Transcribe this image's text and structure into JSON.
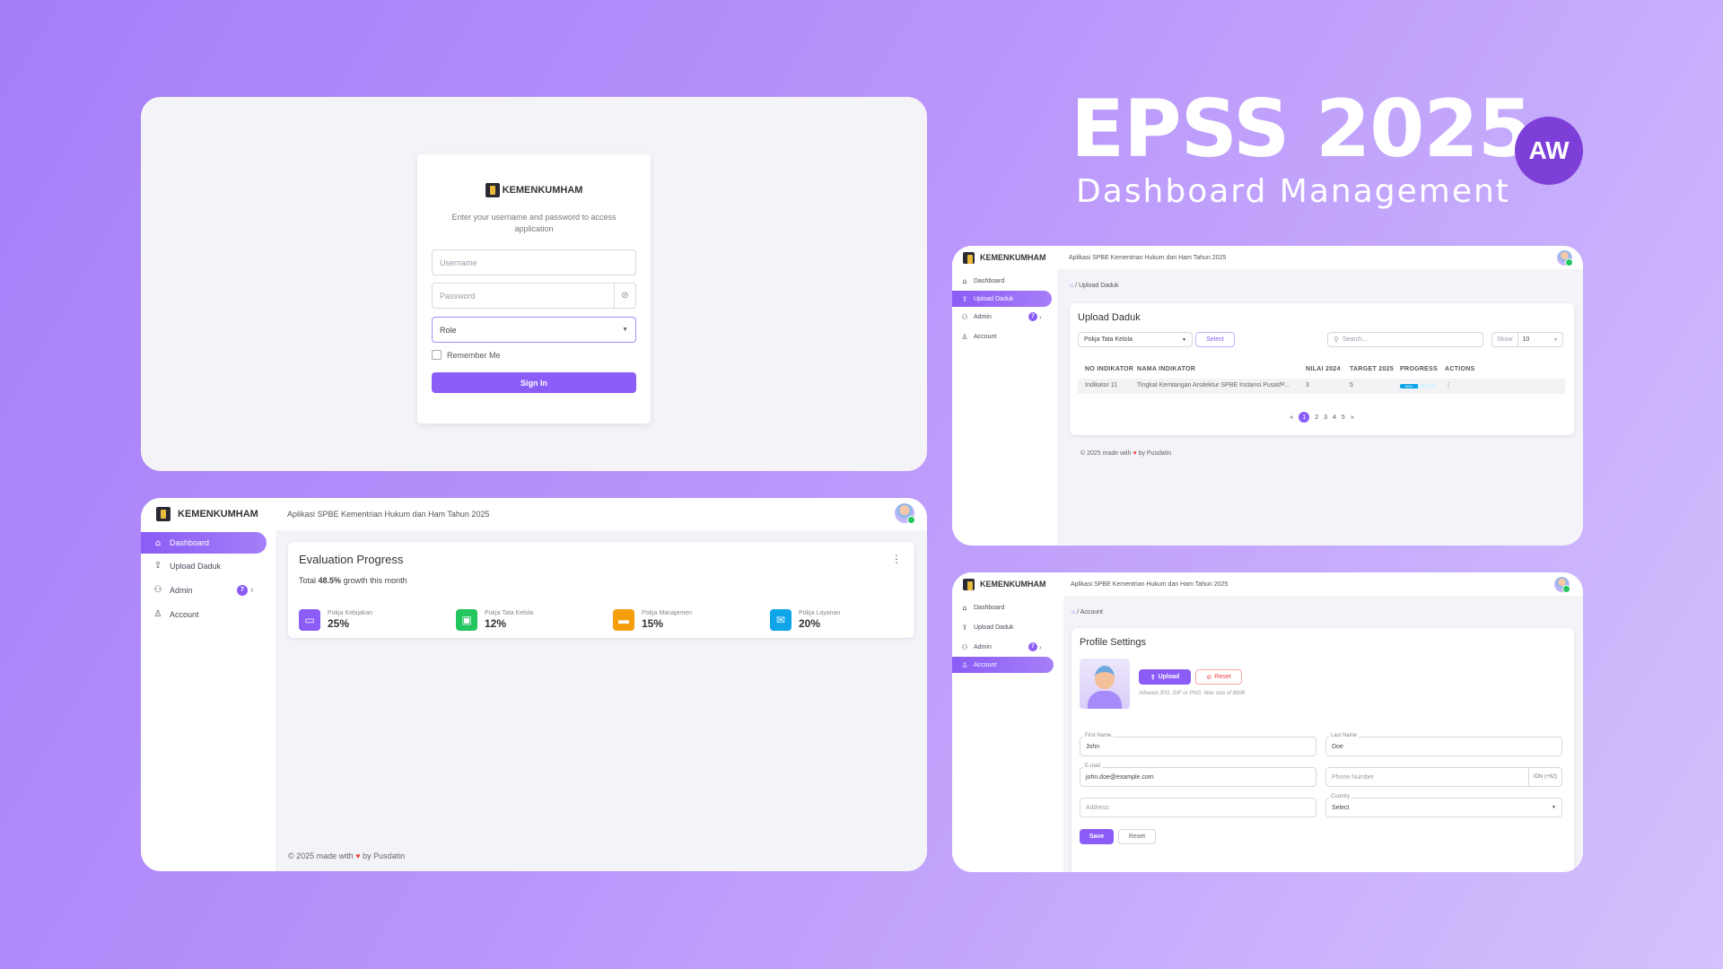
{
  "hero": {
    "title": "EPSS 2025",
    "subtitle": "Dashboard Management",
    "badge": "AW"
  },
  "brand": "KEMENKUMHAM",
  "app_title": "Aplikasi SPBE Kementrian Hukum dan Ham Tahun 2025",
  "footer": {
    "prefix": "© 2025 made with",
    "suffix": "by Pusdatin"
  },
  "login": {
    "brand": "KEMENKUMHAM",
    "instruction": "Enter your username and password to access application",
    "username_placeholder": "Username",
    "password_placeholder": "Password",
    "role_value": "Role",
    "remember_label": "Remember Me",
    "signin_label": "Sign In"
  },
  "nav": {
    "dashboard": "Dashboard",
    "upload": "Upload Daduk",
    "admin": "Admin",
    "admin_badge": "7",
    "account": "Account"
  },
  "dashboard": {
    "title": "Evaluation Progress",
    "summary_prefix": "Total",
    "summary_value": "48.5%",
    "summary_suffix": "growth this month",
    "stats": [
      {
        "label": "Pokja Kebijakan",
        "value": "25%",
        "color": "#8b5cf6",
        "icon": "folder-icon"
      },
      {
        "label": "Pokja Tata Kelola",
        "value": "12%",
        "color": "#22c55e",
        "icon": "calendar-icon"
      },
      {
        "label": "Pokja Manajemen",
        "value": "15%",
        "color": "#f59e0b",
        "icon": "laptop-icon"
      },
      {
        "label": "Pokja Layanan",
        "value": "20%",
        "color": "#0ea5e9",
        "icon": "mail-icon"
      }
    ]
  },
  "upload": {
    "breadcrumb": "Upload Daduk",
    "title": "Upload Daduk",
    "filter_value": "Pokja Tata Kelola",
    "select_label": "Select",
    "search_placeholder": "Search...",
    "show_label": "Show",
    "show_value": "10",
    "columns": [
      "NO INDIKATOR",
      "NAMA INDIKATOR",
      "NILAI 2024",
      "TARGET 2025",
      "PROGRESS",
      "ACTIONS"
    ],
    "rows": [
      {
        "no": "Indikator 11",
        "nama": "Tingkat Kemtangan Arsitektur SPBE Instansi Pusat/P...",
        "nilai": "3",
        "target": "5",
        "progress": "50%",
        "progress_fraction": 0.5
      }
    ],
    "pages": [
      "1",
      "2",
      "3",
      "4",
      "5"
    ],
    "prev": "«",
    "next": "»"
  },
  "account": {
    "breadcrumb": "Account",
    "title": "Profile Settings",
    "upload_label": "Upload",
    "reset_label": "Reset",
    "hint": "Allowed JPG, GIF or PNG. Max size of 800K",
    "first_name_label": "First Name",
    "first_name": "John",
    "last_name_label": "Last Name",
    "last_name": "Doe",
    "email_label": "E-mail",
    "email": "john.doe@example.com",
    "phone_placeholder": "Phone Number",
    "phone_suffix": "IDN (+62)",
    "address_placeholder": "Address",
    "country_label": "Country",
    "country_value": "Select",
    "save_label": "Save",
    "form_reset_label": "Reset"
  }
}
